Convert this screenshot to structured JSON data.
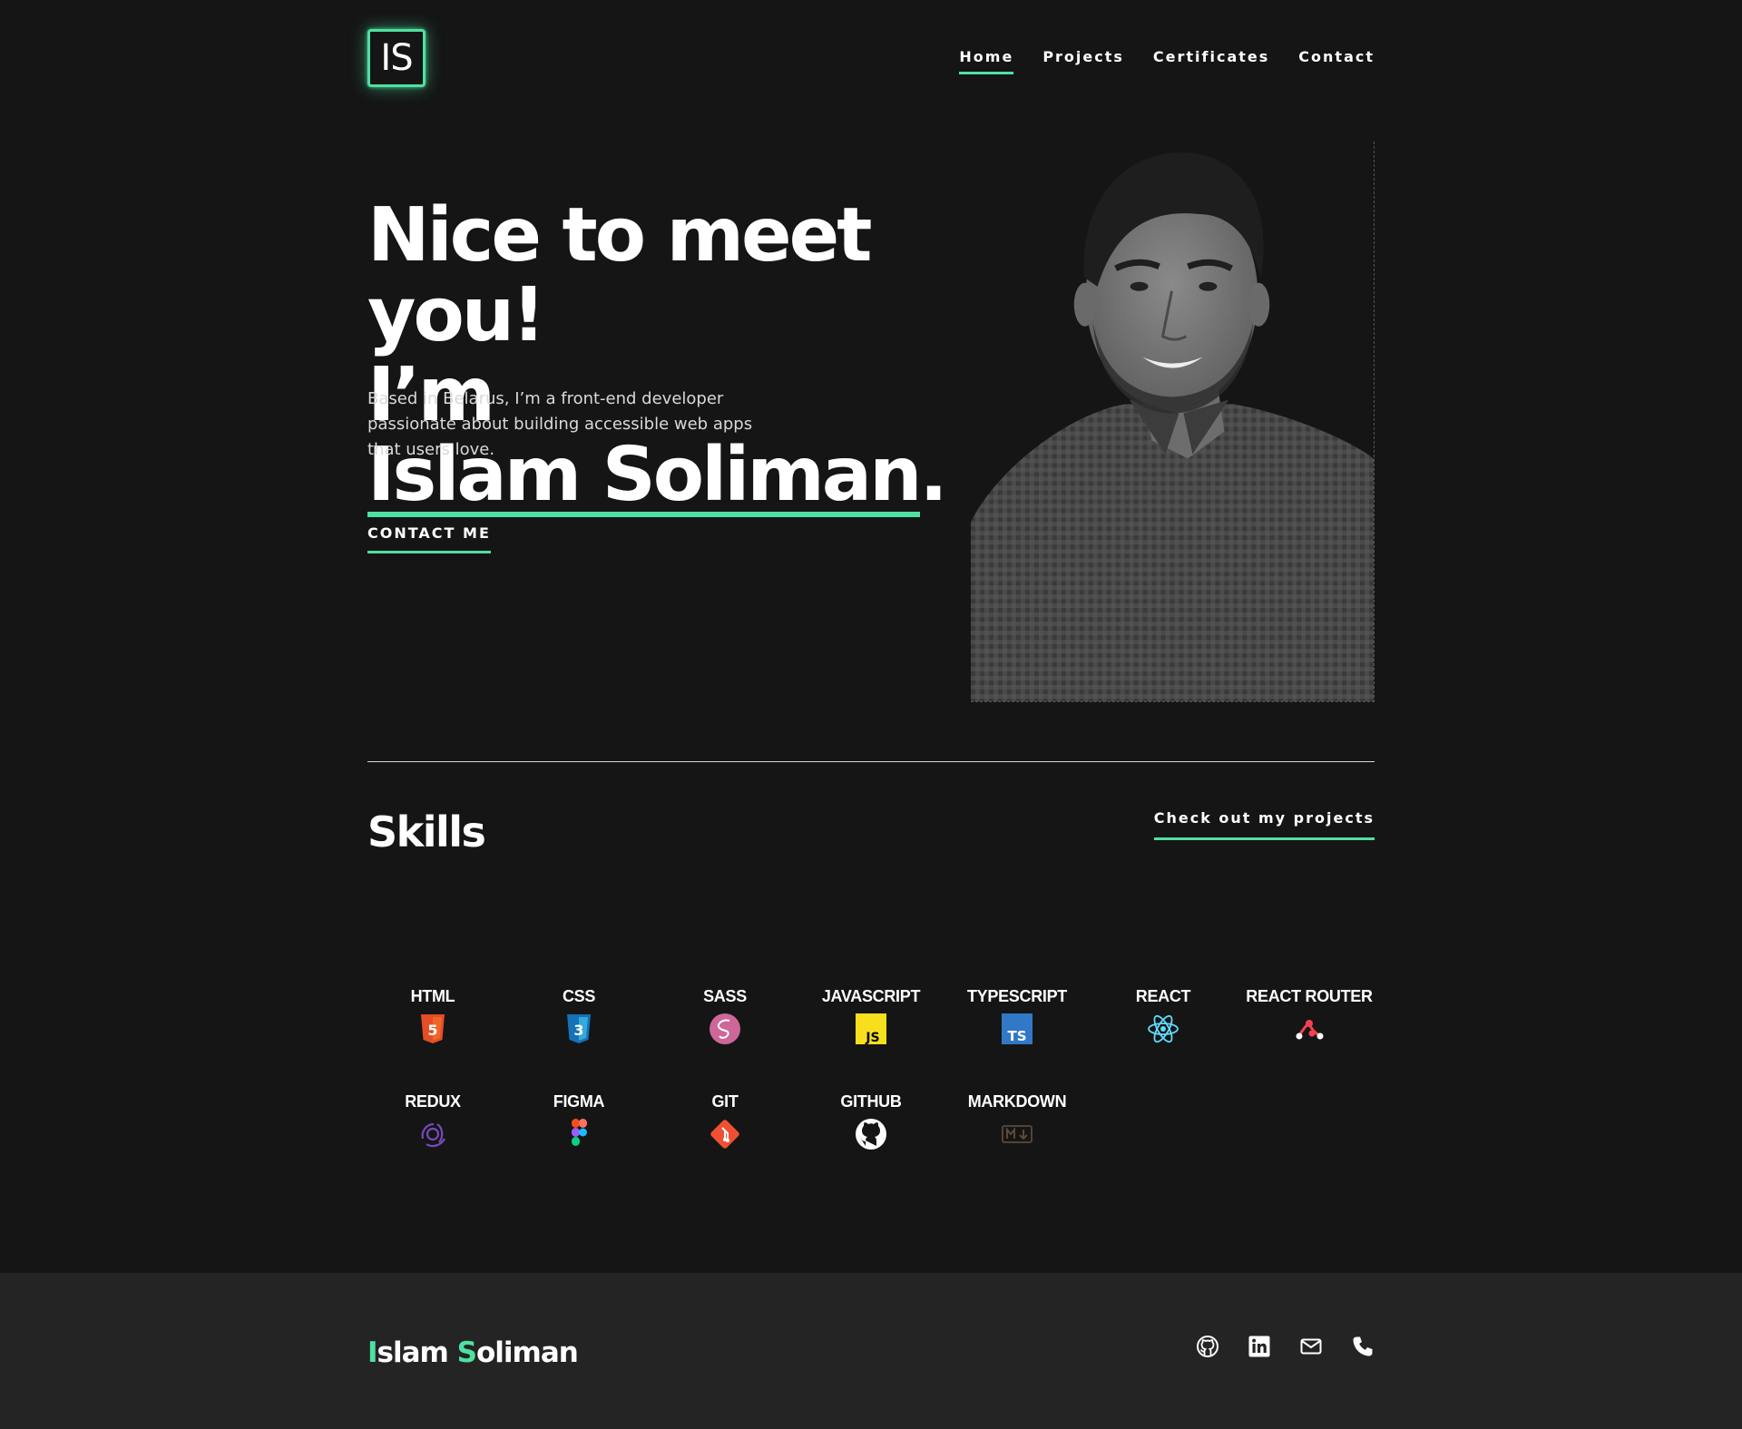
{
  "header": {
    "logo_text": "IS",
    "nav": [
      {
        "label": "Home",
        "active": true
      },
      {
        "label": "Projects",
        "active": false
      },
      {
        "label": "Certificates",
        "active": false
      },
      {
        "label": "Contact",
        "active": false
      }
    ]
  },
  "hero": {
    "title_line1": "Nice to meet you!",
    "title_prefix": "I’m ",
    "name": "Islam Soliman",
    "title_suffix": ".",
    "description": "Based in Belarus, I’m a front-end developer passionate about building accessible web apps that users love.",
    "cta_label": "CONTACT ME"
  },
  "skills": {
    "title": "Skills",
    "link_label": "Check out my projects",
    "items": [
      {
        "label": "HTML",
        "icon": "html5-icon"
      },
      {
        "label": "CSS",
        "icon": "css3-icon"
      },
      {
        "label": "SASS",
        "icon": "sass-icon"
      },
      {
        "label": "JAVASCRIPT",
        "icon": "javascript-icon"
      },
      {
        "label": "TYPESCRIPT",
        "icon": "typescript-icon"
      },
      {
        "label": "REACT",
        "icon": "react-icon"
      },
      {
        "label": "REACT ROUTER",
        "icon": "react-router-icon"
      },
      {
        "label": "REDUX",
        "icon": "redux-icon"
      },
      {
        "label": "FIGMA",
        "icon": "figma-icon"
      },
      {
        "label": "GIT",
        "icon": "git-icon"
      },
      {
        "label": "GITHUB",
        "icon": "github-icon"
      },
      {
        "label": "MARKDOWN",
        "icon": "markdown-icon"
      }
    ]
  },
  "footer": {
    "name_first_initial": "I",
    "name_first_rest": "slam ",
    "name_last_initial": "S",
    "name_last_rest": "oliman",
    "socials": [
      "github-icon",
      "linkedin-icon",
      "email-icon",
      "phone-icon"
    ]
  },
  "colors": {
    "background": "#151515",
    "footer_background": "#242424",
    "accent": "#4ee1a0",
    "text": "#ffffff"
  }
}
